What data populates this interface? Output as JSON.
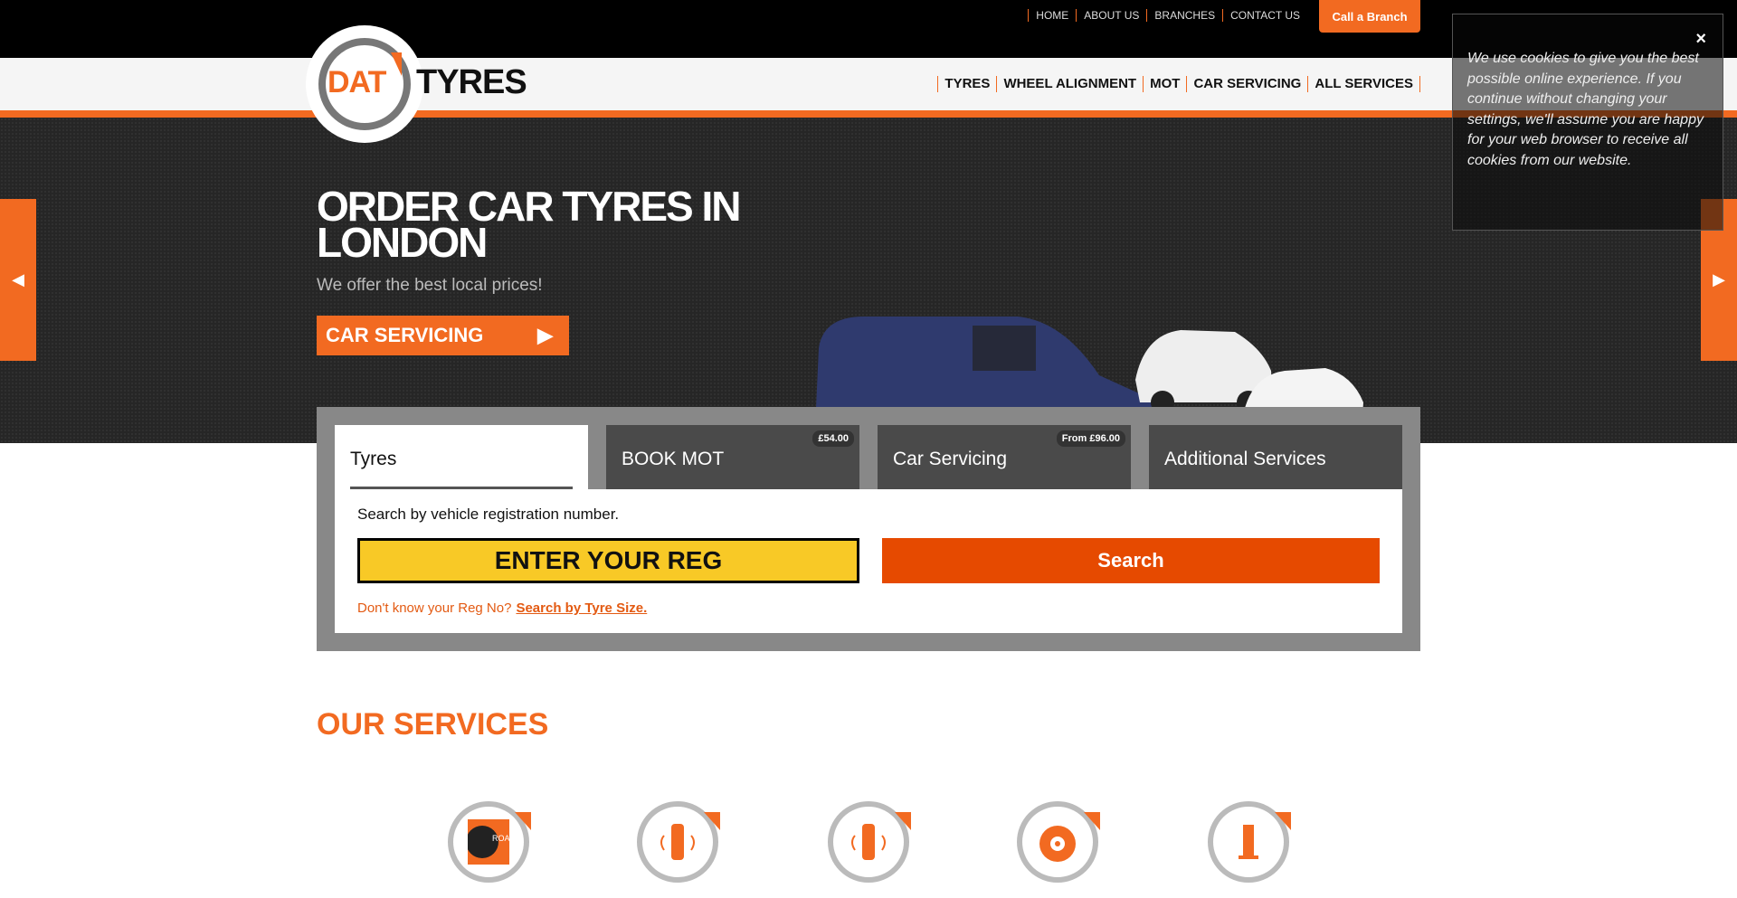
{
  "topnav": {
    "links": [
      "HOME",
      "ABOUT US",
      "BRANCHES",
      "CONTACT US"
    ],
    "cta": "Call a Branch"
  },
  "logo": {
    "text_left": "DAT",
    "text_right": "TYRES"
  },
  "mainnav": [
    "TYRES",
    "WHEEL ALIGNMENT",
    "MOT",
    "CAR SERVICING",
    "ALL SERVICES"
  ],
  "hero": {
    "title": "ORDER CAR TYRES IN LONDON",
    "subtitle": "We offer the best local prices!",
    "button": "CAR SERVICING"
  },
  "cookie": {
    "text": "We use cookies to give you the best possible online experience. If you continue without changing your settings, we'll assume you are happy for your web browser to receive all cookies from our website.",
    "close": "×"
  },
  "search": {
    "tabs": [
      {
        "label": "Tyres",
        "badge": ""
      },
      {
        "label": "BOOK MOT",
        "badge": "£54.00"
      },
      {
        "label": "Car Servicing",
        "badge": "From £96.00"
      },
      {
        "label": "Additional Services",
        "badge": ""
      }
    ],
    "label": "Search by vehicle registration number.",
    "reg_placeholder": "ENTER YOUR REG",
    "button": "Search",
    "hint": "Don't know your Reg No?",
    "hint_link": "Search by Tyre Size."
  },
  "services": {
    "title": "OUR SERVICES",
    "icons": [
      "road-hero-tyre-icon",
      "tyre-rotation-icon",
      "wheel-alignment-icon",
      "brake-disc-icon",
      "exhaust-icon"
    ]
  },
  "colors": {
    "accent": "#f26a21",
    "reg_yellow": "#f8c926",
    "search_orange": "#e64a00"
  }
}
